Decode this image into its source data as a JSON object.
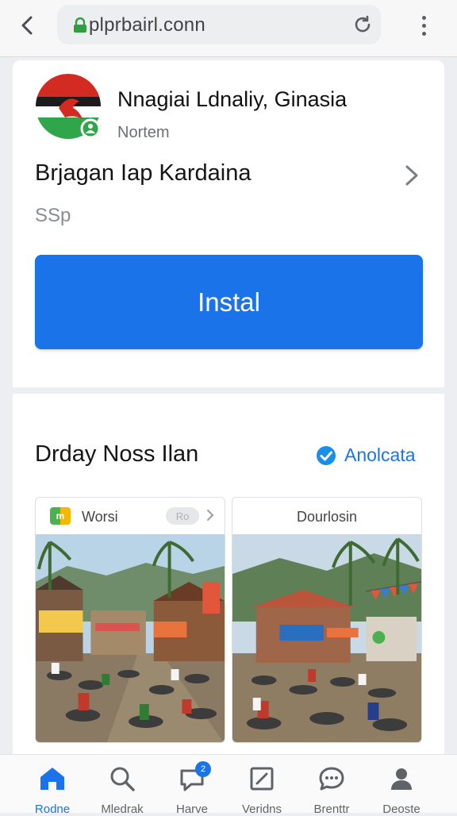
{
  "browser": {
    "url": "plprbairl.conn"
  },
  "app": {
    "title": "Nnagiai Ldnaliy, Ginasia",
    "subtitle": "Nortem",
    "name": "Brjagan Iap Kardaina",
    "size": "SSp",
    "install_label": "Instal",
    "colors": {
      "accent": "#1a73e8"
    }
  },
  "news": {
    "heading": "Drday Noss Ilan",
    "link_label": "Anolcata",
    "items": [
      {
        "label": "Worsi",
        "badge": "m",
        "pill": "Ro"
      },
      {
        "label": "Dourlosin"
      }
    ]
  },
  "nav": {
    "items": [
      {
        "label": "Rodne",
        "icon": "home-icon"
      },
      {
        "label": "Mledrak",
        "icon": "search-icon"
      },
      {
        "label": "Harve",
        "icon": "chat-icon",
        "badge": "2"
      },
      {
        "label": "Veridns",
        "icon": "edit-icon"
      },
      {
        "label": "Brenttr",
        "icon": "message-icon"
      },
      {
        "label": "Deoste",
        "icon": "profile-icon"
      }
    ]
  }
}
